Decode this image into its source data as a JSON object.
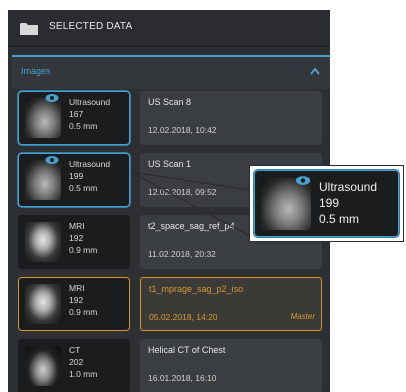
{
  "header": {
    "title": "SELECTED DATA"
  },
  "section": {
    "label": "Images"
  },
  "items": [
    {
      "modality": "Ultrasound",
      "count": "167",
      "thickness": "0.5 mm",
      "name": "US Scan 8",
      "date": "12.02.2018, 10:42",
      "badge": ""
    },
    {
      "modality": "Ultrasound",
      "count": "199",
      "thickness": "0.5 mm",
      "name": "US Scan 1",
      "date": "12.02.2018, 09:52",
      "badge": ""
    },
    {
      "modality": "MRI",
      "count": "192",
      "thickness": "0.9 mm",
      "name": "t2_space_sag_ref_p4",
      "date": "11.02.2018, 20:32",
      "badge": ""
    },
    {
      "modality": "MRI",
      "count": "192",
      "thickness": "0.9 mm",
      "name": "t1_mprage_sag_p2_iso",
      "date": "05.02.2018, 14:20",
      "badge": "Master"
    },
    {
      "modality": "CT",
      "count": "202",
      "thickness": "1.0 mm",
      "name": "Helical CT of Chest",
      "date": "16.01.2018, 16:10",
      "badge": ""
    }
  ],
  "callout": {
    "modality": "Ultrasound",
    "count": "199",
    "thickness": "0.5 mm"
  },
  "colors": {
    "accent": "#4aa0cc",
    "master": "#d5962e",
    "panel": "#2d2f32"
  },
  "icons": {
    "folder": "folder-icon",
    "chevron": "chevron-up-icon",
    "eye": "eye-icon"
  }
}
